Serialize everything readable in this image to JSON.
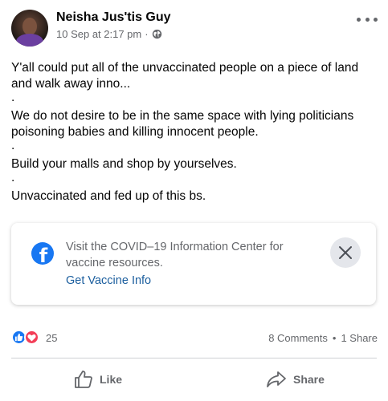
{
  "post": {
    "author": "Neisha Jus'tis Guy",
    "timestamp": "10 Sep at 2:17 pm",
    "separator": "·",
    "privacy_icon": "globe-icon",
    "lines": {
      "l1": "Y'all could put all of the unvaccinated people on a piece of land and walk away inno...",
      "d1": ".",
      "l2": "We do not desire to be in the same space with lying politicians poisoning babies and killing innocent people.",
      "d2": ".",
      "l3": "Build your malls and shop by yourselves.",
      "d3": ".",
      "l4": "Unvaccinated and fed up of this bs."
    }
  },
  "covid_card": {
    "message": "Visit the COVID–19 Information Center for vaccine resources.",
    "link": "Get Vaccine Info",
    "logo_icon": "facebook-icon",
    "close_icon": "close-icon"
  },
  "engagement": {
    "reaction_count": "25",
    "comments": "8 Comments",
    "dot": "•",
    "shares": "1 Share"
  },
  "actions": {
    "like": "Like",
    "share": "Share"
  },
  "colors": {
    "facebook_blue": "#1877f2",
    "love_red": "#f33e58",
    "secondary_text": "#65676b",
    "link": "#1b5e9e"
  }
}
